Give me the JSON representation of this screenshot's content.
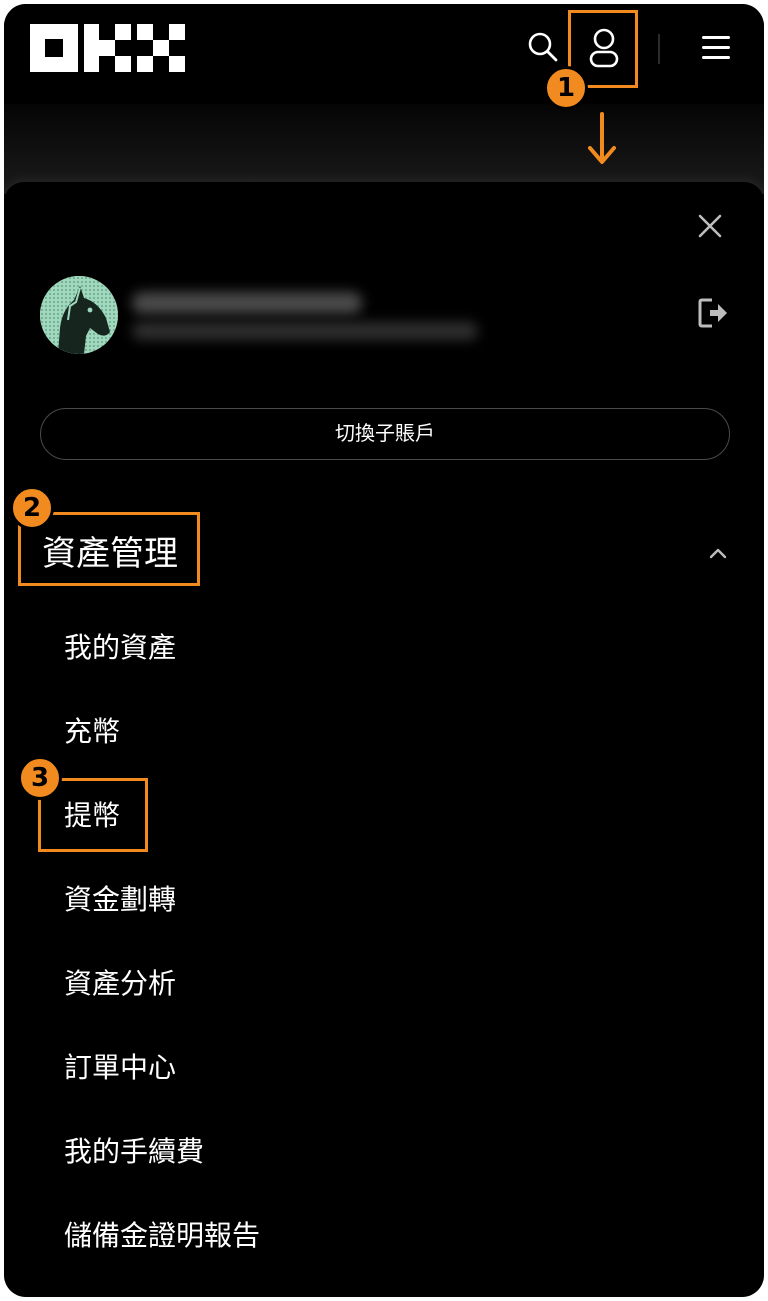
{
  "header": {
    "logo_text": "OKX",
    "icons": [
      "search-icon",
      "user-icon",
      "menu-icon"
    ]
  },
  "annotations": {
    "step1": "1",
    "step2": "2",
    "step3": "3",
    "highlight_color": "#f28b1f"
  },
  "panel": {
    "switch_subaccount": "切換子賬戶",
    "section_title": "資產管理",
    "items": [
      {
        "label": "我的資產"
      },
      {
        "label": "充幣"
      },
      {
        "label": "提幣"
      },
      {
        "label": "資金劃轉"
      },
      {
        "label": "資產分析"
      },
      {
        "label": "訂單中心"
      },
      {
        "label": "我的手續費"
      },
      {
        "label": "儲備金證明報告"
      }
    ]
  }
}
